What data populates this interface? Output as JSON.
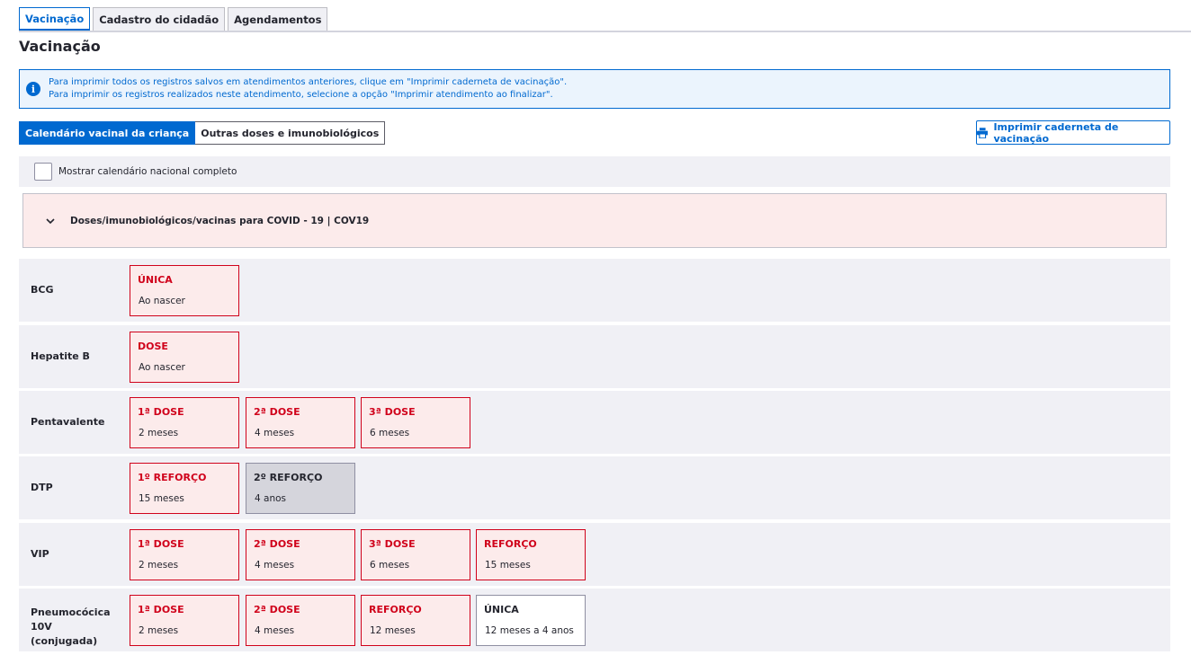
{
  "tabs": [
    {
      "label": "Vacinação",
      "active": true
    },
    {
      "label": "Cadastro do cidadão",
      "active": false
    },
    {
      "label": "Agendamentos",
      "active": false
    }
  ],
  "page_title": "Vacinação",
  "info": {
    "line1": "Para imprimir todos os registros salvos em atendimentos anteriores, clique em \"Imprimir caderneta de vacinação\".",
    "line2": "Para imprimir os registros realizados neste atendimento, selecione a opção \"Imprimir atendimento ao finalizar\".",
    "icon": "info-icon"
  },
  "segments": [
    {
      "label": "Calendário vacinal da criança",
      "active": true
    },
    {
      "label": "Outras doses e imunobiológicos",
      "active": false
    }
  ],
  "print_button": {
    "label": "Imprimir caderneta de vacinação",
    "icon": "printer-icon"
  },
  "checkbox": {
    "label": "Mostrar calendário nacional completo",
    "checked": false
  },
  "covid": {
    "label": "Doses/imunobiológicos/vacinas para COVID - 19 | COV19",
    "icon": "chevron-down-icon"
  },
  "colors": {
    "primary": "#0069d0",
    "danger": "#d0021b",
    "danger_bg": "#fcebeb",
    "row_bg": "#f0f0f5",
    "pending_bg": "#d5d5dc"
  },
  "vaccines": [
    {
      "name": "BCG",
      "doses": [
        {
          "dose": "ÚNICA",
          "age": "Ao nascer",
          "status": "late"
        }
      ]
    },
    {
      "name": "Hepatite B",
      "doses": [
        {
          "dose": "DOSE",
          "age": "Ao nascer",
          "status": "late"
        }
      ]
    },
    {
      "name": "Pentavalente",
      "doses": [
        {
          "dose": "1ª DOSE",
          "age": "2 meses",
          "status": "late"
        },
        {
          "dose": "2ª DOSE",
          "age": "4 meses",
          "status": "late"
        },
        {
          "dose": "3ª DOSE",
          "age": "6 meses",
          "status": "late"
        }
      ]
    },
    {
      "name": "DTP",
      "doses": [
        {
          "dose": "1º REFORÇO",
          "age": "15 meses",
          "status": "late"
        },
        {
          "dose": "2º REFORÇO",
          "age": "4 anos",
          "status": "future"
        }
      ]
    },
    {
      "name": "VIP",
      "doses": [
        {
          "dose": "1ª DOSE",
          "age": "2 meses",
          "status": "late"
        },
        {
          "dose": "2ª DOSE",
          "age": "4 meses",
          "status": "late"
        },
        {
          "dose": "3ª DOSE",
          "age": "6 meses",
          "status": "late"
        },
        {
          "dose": "REFORÇO",
          "age": "15 meses",
          "status": "late"
        }
      ]
    },
    {
      "name": "Pneumocócica 10V (conjugada)",
      "doses": [
        {
          "dose": "1ª DOSE",
          "age": "2 meses",
          "status": "late"
        },
        {
          "dose": "2ª DOSE",
          "age": "4 meses",
          "status": "late"
        },
        {
          "dose": "REFORÇO",
          "age": "12 meses",
          "status": "late"
        },
        {
          "dose": "ÚNICA",
          "age": "12 meses a 4 anos",
          "status": "current"
        }
      ]
    }
  ]
}
